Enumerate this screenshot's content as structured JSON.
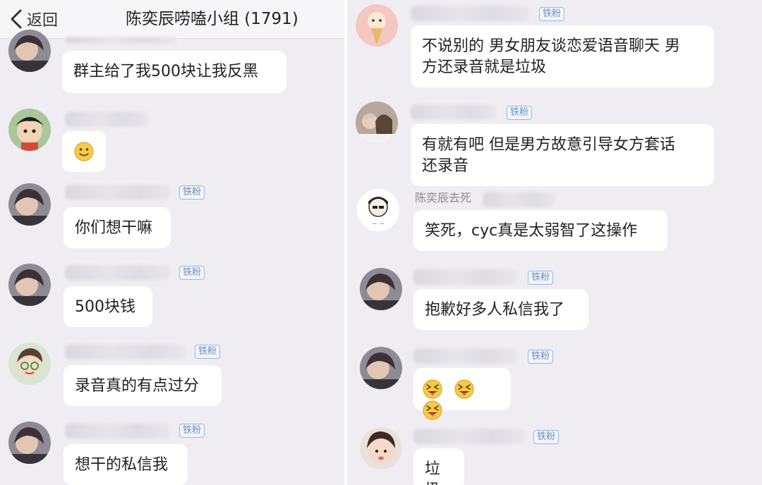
{
  "header": {
    "back_label": "返回",
    "title": "陈奕辰唠嗑小组 (1791)"
  },
  "left_messages": [
    {
      "text": "群主给了我500块让我反黑",
      "badge": ""
    },
    {
      "text": "",
      "badge": "",
      "emoji": [
        "slightly-smiling-face-emoji"
      ]
    },
    {
      "text": "你们想干嘛",
      "badge": "铁粉"
    },
    {
      "text": "500块钱",
      "badge": "铁粉"
    },
    {
      "text": "录音真的有点过分",
      "badge": "铁粉"
    },
    {
      "text": "想干的私信我",
      "badge": "铁粉"
    }
  ],
  "right_messages": [
    {
      "text": "不说别的 男女朋友谈恋爱语音聊天 男方还录音就是垃圾",
      "line1": "不说别的 男女朋友谈恋爱语音聊天 男",
      "line2": "方还录音就是垃圾",
      "badge": "铁粉"
    },
    {
      "text": "有就有吧 但是男方故意引导女方套话还录音",
      "line1": "有就有吧 但是男方故意引导女方套话",
      "line2": "还录音",
      "badge": "铁粉"
    },
    {
      "sender": "陈奕辰去死",
      "text": "笑死，cyc真是太弱智了这操作",
      "badge": ""
    },
    {
      "text": "抱歉好多人私信我了",
      "badge": "铁粉"
    },
    {
      "text": "",
      "badge": "铁粉",
      "emoji": [
        "squinting-face-with-tongue-emoji",
        "squinting-face-with-tongue-emoji",
        "squinting-face-with-tongue-emoji"
      ]
    },
    {
      "text": "垃圾",
      "badge": "铁粉"
    }
  ],
  "colors": {
    "chat_background": "#efedf2",
    "bubble": "#ffffff",
    "badge_text": "#6b8fc7"
  }
}
